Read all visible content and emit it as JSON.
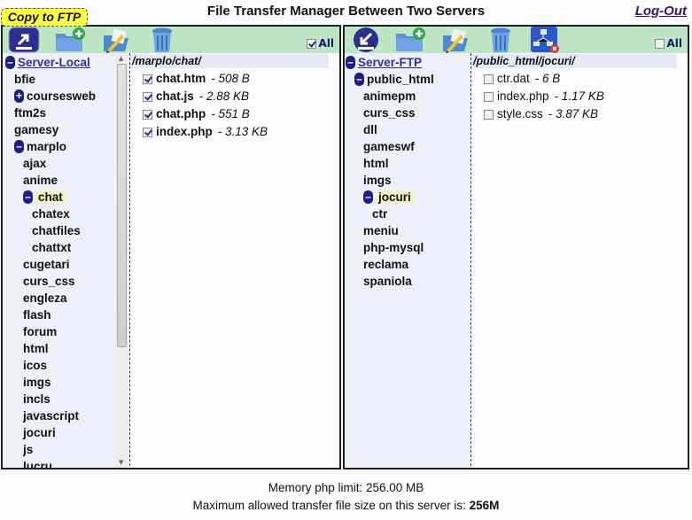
{
  "header": {
    "title": "File Transfer Manager Between Two Servers",
    "logout_label": "Log-Out",
    "copy_badge": "Copy to FTP"
  },
  "local": {
    "toolbar": {
      "icons": [
        "upload-to-ftp-icon",
        "new-folder-icon",
        "rename-icon",
        "delete-icon"
      ],
      "all_label": "All",
      "all_checked": true
    },
    "tree": [
      {
        "label": "Server-Local",
        "depth": 0,
        "toggle": "-",
        "root": true
      },
      {
        "label": "bfie",
        "depth": 1
      },
      {
        "label": "coursesweb",
        "depth": 1,
        "toggle": "+"
      },
      {
        "label": "ftm2s",
        "depth": 1
      },
      {
        "label": "gamesy",
        "depth": 1
      },
      {
        "label": "marplo",
        "depth": 1,
        "toggle": "-"
      },
      {
        "label": "ajax",
        "depth": 2
      },
      {
        "label": "anime",
        "depth": 2
      },
      {
        "label": "chat",
        "depth": 2,
        "toggle": "-",
        "selected": true
      },
      {
        "label": "chatex",
        "depth": 3
      },
      {
        "label": "chatfiles",
        "depth": 3
      },
      {
        "label": "chattxt",
        "depth": 3
      },
      {
        "label": "cugetari",
        "depth": 2
      },
      {
        "label": "curs_css",
        "depth": 2
      },
      {
        "label": "engleza",
        "depth": 2
      },
      {
        "label": "flash",
        "depth": 2
      },
      {
        "label": "forum",
        "depth": 2
      },
      {
        "label": "html",
        "depth": 2
      },
      {
        "label": "icos",
        "depth": 2
      },
      {
        "label": "imgs",
        "depth": 2
      },
      {
        "label": "incls",
        "depth": 2
      },
      {
        "label": "javascript",
        "depth": 2
      },
      {
        "label": "jocuri",
        "depth": 2
      },
      {
        "label": "js",
        "depth": 2
      },
      {
        "label": "lucru",
        "depth": 2
      }
    ],
    "path": "/marplo/chat/",
    "files": [
      {
        "name": "chat.htm",
        "size": "- 508 B",
        "checked": true
      },
      {
        "name": "chat.js",
        "size": "- 2.88 KB",
        "checked": true
      },
      {
        "name": "chat.php",
        "size": "- 551 B",
        "checked": true
      },
      {
        "name": "index.php",
        "size": "- 3.13 KB",
        "checked": true
      }
    ]
  },
  "remote": {
    "toolbar": {
      "icons": [
        "download-to-local-icon",
        "new-folder-icon",
        "rename-icon",
        "delete-icon",
        "disconnect-icon"
      ],
      "all_label": "All",
      "all_checked": false
    },
    "tree": [
      {
        "label": "Server-FTP",
        "depth": 0,
        "toggle": "-",
        "root": true
      },
      {
        "label": "public_html",
        "depth": 1,
        "toggle": "-"
      },
      {
        "label": "animepm",
        "depth": 2
      },
      {
        "label": "curs_css",
        "depth": 2
      },
      {
        "label": "dll",
        "depth": 2
      },
      {
        "label": "gameswf",
        "depth": 2
      },
      {
        "label": "html",
        "depth": 2
      },
      {
        "label": "imgs",
        "depth": 2
      },
      {
        "label": "jocuri",
        "depth": 2,
        "toggle": "-",
        "selected": true
      },
      {
        "label": "ctr",
        "depth": 3
      },
      {
        "label": "meniu",
        "depth": 2
      },
      {
        "label": "php-mysql",
        "depth": 2
      },
      {
        "label": "reclama",
        "depth": 2
      },
      {
        "label": "spaniola",
        "depth": 2
      }
    ],
    "path": "/public_html/jocuri/",
    "files": [
      {
        "name": "ctr.dat",
        "size": "- 6 B",
        "checked": false
      },
      {
        "name": "index.php",
        "size": "- 1.17 KB",
        "checked": false
      },
      {
        "name": "style.css",
        "size": "- 3.87 KB",
        "checked": false
      }
    ]
  },
  "footer": {
    "memory_label": "Memory php limit: 256.00 MB",
    "max_size_label": "Maximum allowed transfer file size on this server is: ",
    "max_size_value": "256M"
  }
}
